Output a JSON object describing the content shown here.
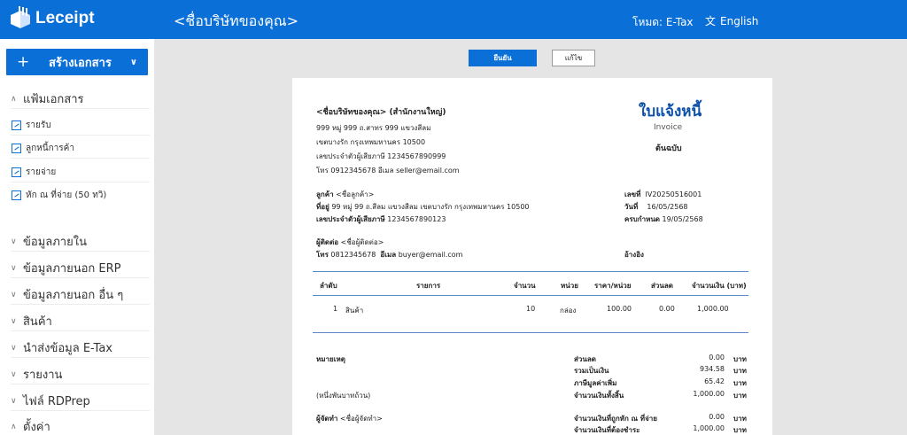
{
  "app": {
    "logo_text": "Leceipt",
    "company_title": "<ชื่อบริษัทของคุณ>",
    "mode_label": "โหมด: E-Tax",
    "language_label": "English"
  },
  "sidebar": {
    "create_button": "สร้างเอกสาร",
    "documents_group": "แฟ้มเอกสาร",
    "document_items": [
      "รายรับ",
      "ลูกหนี้การค้า",
      "รายจ่าย",
      "หัก ณ ที่จ่าย (50 ทวิ)"
    ],
    "groups": [
      "ข้อมูลภายใน",
      "ข้อมูลภายนอก ERP",
      "ข้อมูลภายนอก อื่น ๆ",
      "สินค้า",
      "นำส่งข้อมูล E-Tax",
      "รายงาน",
      "ไฟล์ RDPrep",
      "ตั้งค่า"
    ]
  },
  "actions": {
    "confirm": "ยืนยัน",
    "edit": "แก้ไข"
  },
  "document": {
    "seller_name": "<ชื่อบริษัทของคุณ> (สำนักงานใหญ่)",
    "seller_addr1": "999 หมู่ 999 ถ.สาทร 999 แขวงสีลม",
    "seller_addr2": "เขตบางรัก กรุงเทพมหานคร 10500",
    "seller_tax": "เลขประจำตัวผู้เสียภาษี 1234567890999",
    "seller_contact": "โทร 0912345678  อีเมล seller@email.com",
    "title": "ใบแจ้งหนี้",
    "subtitle": "Invoice",
    "copy_label": "ต้นฉบับ",
    "customer_label": "ลูกค้า",
    "customer_value": "<ชื่อลูกค้า>",
    "address_label": "ที่อยู่",
    "address_value": "99 หมู่ 99 ถ.สีลม แขวงสีลม เขตบางรัก กรุงเทพมหานคร 10500",
    "cust_tax_label": "เลขประจำตัวผู้เสียภาษี",
    "cust_tax_value": "1234567890123",
    "no_label": "เลขที่",
    "no_value": "IV20250516001",
    "date_label": "วันที่",
    "date_value": "16/05/2568",
    "due_label": "ครบกำหนด",
    "due_value": "19/05/2568",
    "contact_label": "ผู้ติดต่อ",
    "contact_value": "<ชื่อผู้ติดต่อ>",
    "phone_label": "โทร",
    "phone_value": "0812345678",
    "email_label": "อีเมล",
    "email_value": "buyer@email.com",
    "ref_label": "อ้างอิง",
    "table_headers": [
      "ลำดับ",
      "รายการ",
      "จำนวน",
      "หน่วย",
      "ราคา/หน่วย",
      "ส่วนลด",
      "จำนวนเงิน (บาท)"
    ],
    "rows": [
      {
        "no": "1",
        "item": "สินค้า",
        "qty": "10",
        "unit": "กล่อง",
        "price": "100.00",
        "discount": "0.00",
        "amount": "1,000.00"
      }
    ],
    "note_label": "หมายเหตุ",
    "amount_text": "(หนึ่งพันบาทถ้วน)",
    "issuer_label": "ผู้จัดทำ",
    "issuer_value": "<ชื่อผู้จัดทำ>",
    "currency": "บาท",
    "summary": [
      {
        "label": "ส่วนลด",
        "value": "0.00"
      },
      {
        "label": "รวมเป็นเงิน",
        "value": "934.58"
      },
      {
        "label": "ภาษีมูลค่าเพิ่ม",
        "value": "65.42"
      },
      {
        "label": "จำนวนเงินทั้งสิ้น",
        "value": "1,000.00"
      },
      {
        "label": "จำนวนเงินที่ถูกหัก ณ ที่จ่าย",
        "value": "0.00"
      },
      {
        "label": "จำนวนเงินที่ต้องชำระ",
        "value": "1,000.00"
      }
    ]
  }
}
